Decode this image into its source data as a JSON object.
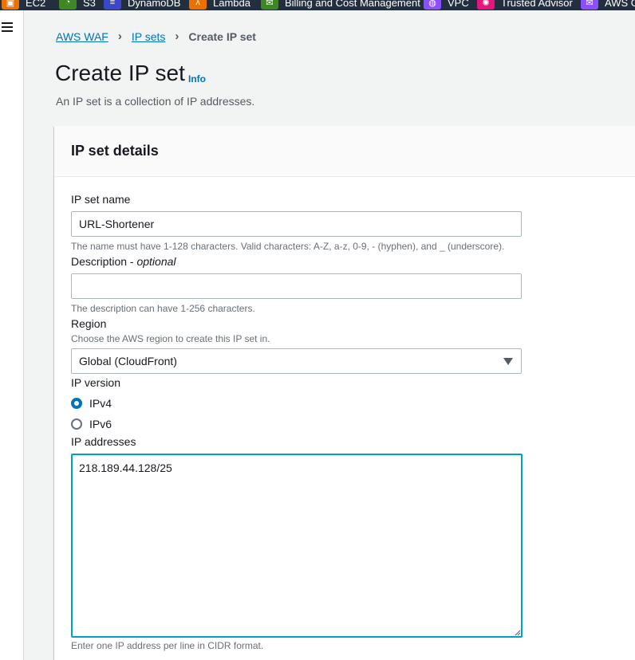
{
  "favorites_bar": {
    "items": [
      {
        "label": "EC2",
        "color": "#ed7100",
        "icon": "ec2-icon"
      },
      {
        "label": "S3",
        "color": "#3f8624",
        "icon": "s3-icon"
      },
      {
        "label": "DynamoDB",
        "color": "#3b48cc",
        "icon": "dynamodb-icon"
      },
      {
        "label": "Lambda",
        "color": "#ed7100",
        "icon": "lambda-icon"
      },
      {
        "label": "Billing and Cost Management",
        "color": "#3f8624",
        "icon": "billing-icon"
      },
      {
        "label": "VPC",
        "color": "#8c4fff",
        "icon": "vpc-icon"
      },
      {
        "label": "Trusted Advisor",
        "color": "#e7157b",
        "icon": "trusted-advisor-icon"
      },
      {
        "label": "AWS G",
        "color": "#8c4fff",
        "icon": "aws-service-icon"
      }
    ]
  },
  "breadcrumb": {
    "items": [
      "AWS WAF",
      "IP sets"
    ],
    "current": "Create IP set"
  },
  "page": {
    "title": "Create IP set",
    "info_link": "Info",
    "description": "An IP set is a collection of IP addresses."
  },
  "panel": {
    "title": "IP set details"
  },
  "form": {
    "name_label": "IP set name",
    "name_value": "URL-Shortener",
    "name_hint": "The name must have 1-128 characters. Valid characters: A-Z, a-z, 0-9, - (hyphen), and _ (underscore).",
    "description_label": "Description - ",
    "description_optional": "optional",
    "description_value": "",
    "description_hint": "The description can have 1-256 characters.",
    "region_label": "Region",
    "region_hint": "Choose the AWS region to create this IP set in.",
    "region_value": "Global (CloudFront)",
    "ip_version_label": "IP version",
    "ip_version_options": [
      "IPv4",
      "IPv6"
    ],
    "ip_version_selected": "IPv4",
    "ip_addresses_label": "IP addresses",
    "ip_addresses_value": "218.189.44.128/25",
    "ip_addresses_hint": "Enter one IP address per line in CIDR format."
  },
  "colors": {
    "link": "#0073bb",
    "focus": "#00a1c9",
    "topbar": "#232f3e"
  }
}
